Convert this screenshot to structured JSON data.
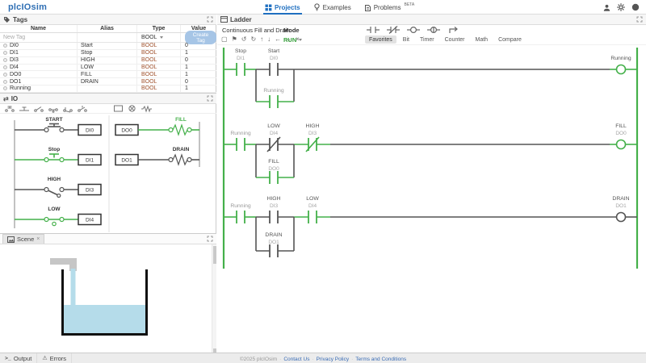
{
  "topbar": {
    "brand": "plcIOsim",
    "nav": [
      {
        "label": "Projects",
        "active": true
      },
      {
        "label": "Examples",
        "active": false
      },
      {
        "label": "Problems",
        "active": false,
        "badge": "BETA"
      }
    ]
  },
  "tags_panel": {
    "title": "Tags",
    "columns": [
      "Name",
      "Alias",
      "Type",
      "Value"
    ],
    "new_tag": {
      "placeholder": "New Tag",
      "type": "BOOL",
      "create_label": "Create Tag"
    },
    "rows": [
      {
        "name": "DI0",
        "alias": "Start",
        "type": "BOOL",
        "value": "0"
      },
      {
        "name": "DI1",
        "alias": "Stop",
        "type": "BOOL",
        "value": "1"
      },
      {
        "name": "DI3",
        "alias": "HIGH",
        "type": "BOOL",
        "value": "0"
      },
      {
        "name": "DI4",
        "alias": "LOW",
        "type": "BOOL",
        "value": "1"
      },
      {
        "name": "DO0",
        "alias": "FILL",
        "type": "BOOL",
        "value": "1"
      },
      {
        "name": "DO1",
        "alias": "DRAIN",
        "type": "BOOL",
        "value": "0"
      },
      {
        "name": "Running",
        "alias": "",
        "type": "BOOL",
        "value": "1"
      }
    ]
  },
  "io_panel": {
    "title": "IO",
    "inputs": [
      {
        "label": "START",
        "address": "DI0",
        "state": false
      },
      {
        "label": "Stop",
        "address": "DI1",
        "state": true
      },
      {
        "label": "HIGH",
        "address": "DI3",
        "state": false
      },
      {
        "label": "LOW",
        "address": "DI4",
        "state": true
      }
    ],
    "outputs": [
      {
        "label": "FILL",
        "address": "DO0",
        "state": true
      },
      {
        "label": "DRAIN",
        "address": "DO1",
        "state": false
      }
    ]
  },
  "scene_panel": {
    "tab_label": "Scene",
    "close_label": "×"
  },
  "ladder_panel": {
    "title": "Ladder",
    "program_name": "Continuous Fill and Drain",
    "mode_label": "Mode",
    "mode_value": "RUN",
    "toolbar": [
      {
        "name": "select",
        "glyph": "▢"
      },
      {
        "name": "flag",
        "glyph": "⚑"
      },
      {
        "name": "undo",
        "glyph": "↺"
      },
      {
        "name": "redo",
        "glyph": "↻"
      },
      {
        "name": "move-up",
        "glyph": "↑"
      },
      {
        "name": "move-down",
        "glyph": "↓"
      },
      {
        "name": "move-left",
        "glyph": "←"
      },
      {
        "name": "move-right",
        "glyph": "→"
      },
      {
        "name": "delete",
        "glyph": "×"
      }
    ],
    "instruction_tabs": [
      {
        "label": "Favorites",
        "active": true
      },
      {
        "label": "Bit",
        "active": false
      },
      {
        "label": "Timer",
        "active": false
      },
      {
        "label": "Counter",
        "active": false
      },
      {
        "label": "Math",
        "active": false
      },
      {
        "label": "Compare",
        "active": false
      }
    ],
    "rungs": {
      "r1": {
        "c1_name": "Stop",
        "c1_addr": "DI1",
        "c2_name": "Start",
        "c2_addr": "DI0",
        "branch_name": "Running",
        "coil_name": "Running"
      },
      "r2": {
        "c1_name": "Running",
        "c2_name": "LOW",
        "c2_addr": "DI4",
        "c3_name": "HIGH",
        "c3_addr": "DI3",
        "branch_name": "FILL",
        "branch_addr": "DO0",
        "coil_name": "FILL",
        "coil_addr": "DO0"
      },
      "r3": {
        "c1_name": "Running",
        "c2_name": "HIGH",
        "c2_addr": "DI3",
        "c3_name": "LOW",
        "c3_addr": "DI4",
        "branch_name": "DRAIN",
        "branch_addr": "DO1",
        "coil_name": "DRAIN",
        "coil_addr": "DO1"
      }
    }
  },
  "bottom_bar": {
    "output_label": "Output",
    "errors_label": "Errors",
    "errors_icon": "⚠",
    "terminal_icon": ">_"
  },
  "footer": {
    "copyright": "©2025 plcIOsim",
    "links": [
      "Contact Us",
      "Privacy Policy",
      "Terms and Conditions"
    ]
  },
  "colors": {
    "energized": "#44b04a",
    "brand_blue": "#2f6fb4",
    "active_nav": "#1f6fc0"
  }
}
